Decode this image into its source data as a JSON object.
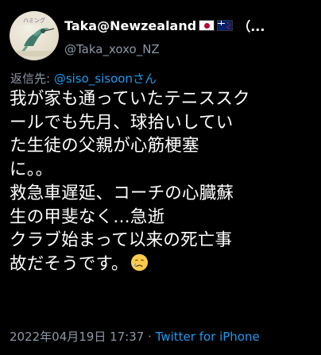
{
  "user": {
    "display_name": "Taka@Newzealand",
    "flags": [
      "flag-japan-icon",
      "flag-new-zealand-icon"
    ],
    "trailing": "（...",
    "handle": "@Taka_xoxo_NZ"
  },
  "reply": {
    "prefix": "返信先: ",
    "mention": "@siso_sisoonさん"
  },
  "tweet": {
    "lines": [
      "我が家も通っていたテニススク",
      "ールでも先月、球拾いしてい",
      "た生徒の父親が心筋梗塞",
      "に。。",
      "救急車遅延、コーチの心臓蘇",
      "生の甲斐なく…急逝",
      "クラブ始まって以来の死亡事",
      "故だそうです。"
    ],
    "emoji": "crying-face-icon"
  },
  "meta": {
    "date": "2022年04月19日 17:37",
    "separator": " · ",
    "source": "Twitter for iPhone"
  },
  "colors": {
    "background": "#000000",
    "text": "#ffffff",
    "secondary": "#8b98a5",
    "link": "#1d9bf0"
  }
}
